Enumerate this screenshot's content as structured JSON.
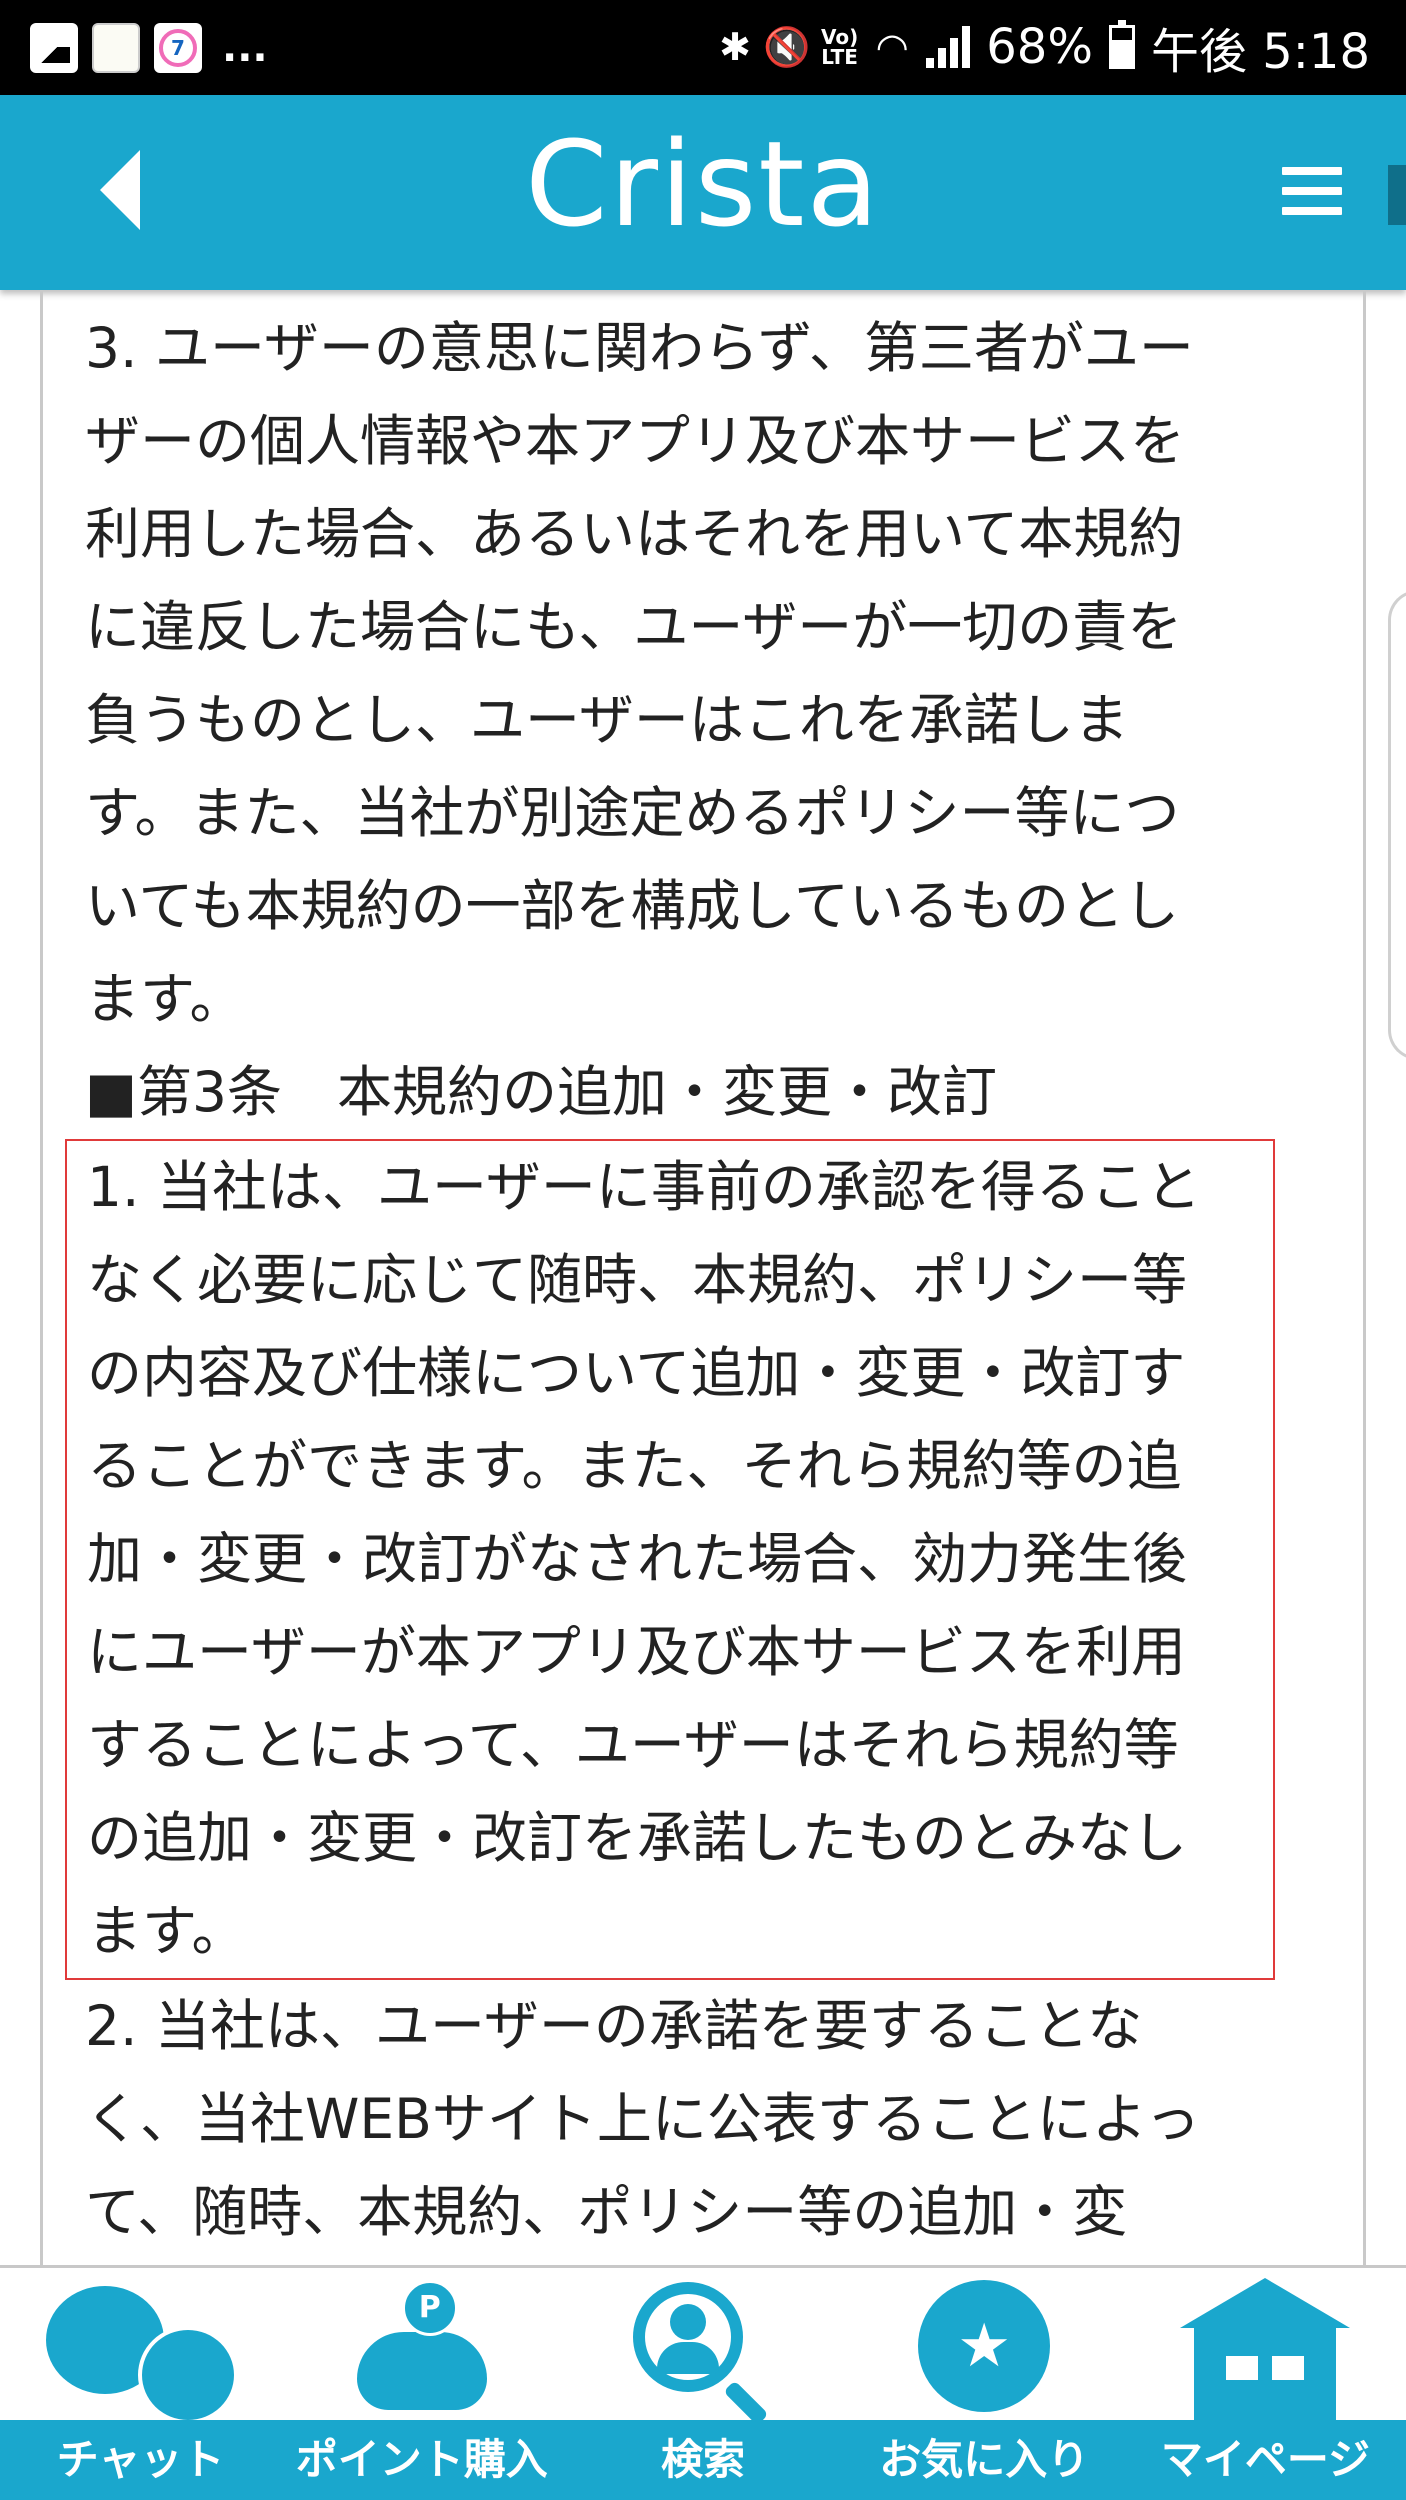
{
  "status_bar": {
    "battery": "68%",
    "time": "午後 5:18",
    "more": "...",
    "network": "LTE"
  },
  "header": {
    "title": "Crista"
  },
  "document": {
    "para_3": "3. ユーザーの意思に関わらず、第三者がユー\nザーの個人情報や本アプリ及び本サービスを\n利用した場合、あるいはそれを用いて本規約\nに違反した場合にも、ユーザーが一切の責を\n負うものとし、ユーザーはこれを承諾しま\nす。また、当社が別途定めるポリシー等につ\nいても本規約の一部を構成しているものとし\nます。",
    "heading_article3": "■第3条　本規約の追加・変更・改訂",
    "para_1_highlighted": "1. 当社は、ユーザーに事前の承認を得ること\nなく必要に応じて随時、本規約、ポリシー等\nの内容及び仕様について追加・変更・改訂す\nることができます。また、それら規約等の追\n加・変更・改訂がなされた場合、効力発生後\nにユーザーが本アプリ及び本サービスを利用\nすることによって、ユーザーはそれら規約等\nの追加・変更・改訂を承諾したものとみなし\nます。",
    "para_2": "2. 当社は、ユーザーの承諾を要することな\nく、当社WEBサイト上に公表することによっ\nて、随時、本規約、ポリシー等の追加・変"
  },
  "bottom_nav": {
    "items": [
      {
        "label": "チャット",
        "icon": "chat-icon"
      },
      {
        "label": "ポイント購入",
        "icon": "piggy-bank-icon"
      },
      {
        "label": "検索",
        "icon": "search-user-icon"
      },
      {
        "label": "お気に入り",
        "icon": "star-icon"
      },
      {
        "label": "マイページ",
        "icon": "house-icon"
      }
    ]
  },
  "colors": {
    "accent": "#1aa7cd",
    "highlight_border": "#e03a3a"
  }
}
